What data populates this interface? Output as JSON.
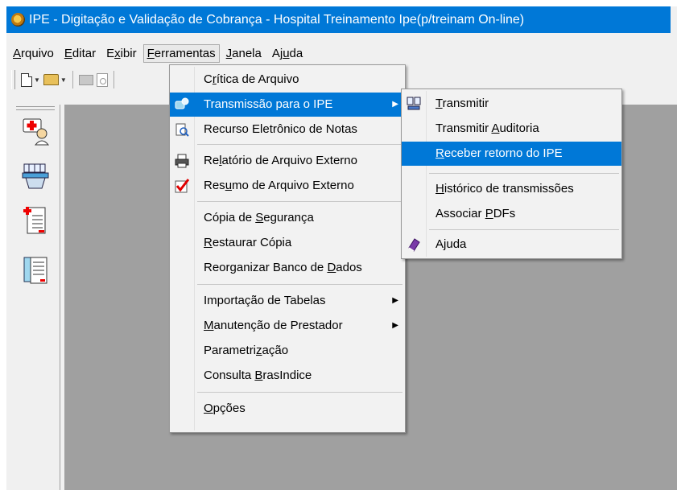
{
  "window": {
    "title": "IPE - Digitação e Validação de Cobrança - Hospital Treinamento Ipe(p/treinam On-line)"
  },
  "menubar": [
    {
      "id": "arquivo",
      "ul": "A",
      "rest": "rquivo"
    },
    {
      "id": "editar",
      "ul": "E",
      "rest": "ditar"
    },
    {
      "id": "exibir",
      "pre": "E",
      "ul": "x",
      "rest": "ibir"
    },
    {
      "id": "ferramentas",
      "ul": "F",
      "rest": "erramentas"
    },
    {
      "id": "janela",
      "ul": "J",
      "rest": "anela"
    },
    {
      "id": "ajuda",
      "pre": "Aj",
      "ul": "u",
      "rest": "da"
    }
  ],
  "toolbar": {
    "icons": [
      "new-document-icon",
      "open-folder-icon",
      "print-icon",
      "print-preview-icon"
    ]
  },
  "sidebar": {
    "icons": [
      "ambulance-patient-icon",
      "hospital-bed-icon",
      "medical-form-icon",
      "clipboard-list-icon"
    ]
  },
  "ferramentas_menu": {
    "items": [
      {
        "pre": "C",
        "ul": "r",
        "rest": "ítica de Arquivo",
        "icon": ""
      },
      {
        "pre": "",
        "ul": "",
        "rest": "Transmissão para o IPE",
        "icon": "transmission-icon",
        "highlighted": true,
        "submenu": true
      },
      {
        "pre": "",
        "ul": "",
        "rest": "Recurso Eletrônico de Notas",
        "icon": "magnifier-document-icon"
      },
      {
        "pre": "Re",
        "ul": "l",
        "rest": "atório de Arquivo Externo",
        "icon": "printer-icon"
      },
      {
        "pre": "Res",
        "ul": "u",
        "rest": "mo de Arquivo Externo",
        "icon": "checkmark-icon"
      },
      {
        "pre": "Cópia de ",
        "ul": "S",
        "rest": "egurança",
        "icon": ""
      },
      {
        "pre": "",
        "ul": "R",
        "rest": "estaurar Cópia",
        "icon": ""
      },
      {
        "pre": "Reorganizar Banco de ",
        "ul": "D",
        "rest": "ados",
        "icon": ""
      },
      {
        "pre": "Importação de Tabelas",
        "ul": "",
        "rest": "",
        "icon": "",
        "submenu": true
      },
      {
        "pre": "",
        "ul": "M",
        "rest": "anutenção de Prestador",
        "icon": "",
        "submenu": true
      },
      {
        "pre": "Parametri",
        "ul": "z",
        "rest": "ação",
        "icon": ""
      },
      {
        "pre": "Consulta ",
        "ul": "B",
        "rest": "rasIndice",
        "icon": ""
      },
      {
        "pre": "",
        "ul": "O",
        "rest": "pções",
        "icon": ""
      }
    ]
  },
  "transmissao_submenu": {
    "items": [
      {
        "pre": "",
        "ul": "T",
        "rest": "ransmitir",
        "icon": "computer-network-icon"
      },
      {
        "pre": "Transmitir ",
        "ul": "A",
        "rest": "uditoria",
        "icon": ""
      },
      {
        "pre": "",
        "ul": "R",
        "rest": "eceber retorno do IPE",
        "icon": "",
        "highlighted": true
      },
      {
        "pre": "",
        "ul": "H",
        "rest": "istórico de transmissões",
        "icon": ""
      },
      {
        "pre": "Associar ",
        "ul": "P",
        "rest": "DFs",
        "icon": ""
      },
      {
        "pre": "A",
        "ul": "j",
        "rest": "uda",
        "icon": "help-book-icon"
      }
    ]
  },
  "colors": {
    "accent": "#0078d7",
    "mdi_background": "#a0a0a0",
    "chrome": "#f0f0f0"
  }
}
